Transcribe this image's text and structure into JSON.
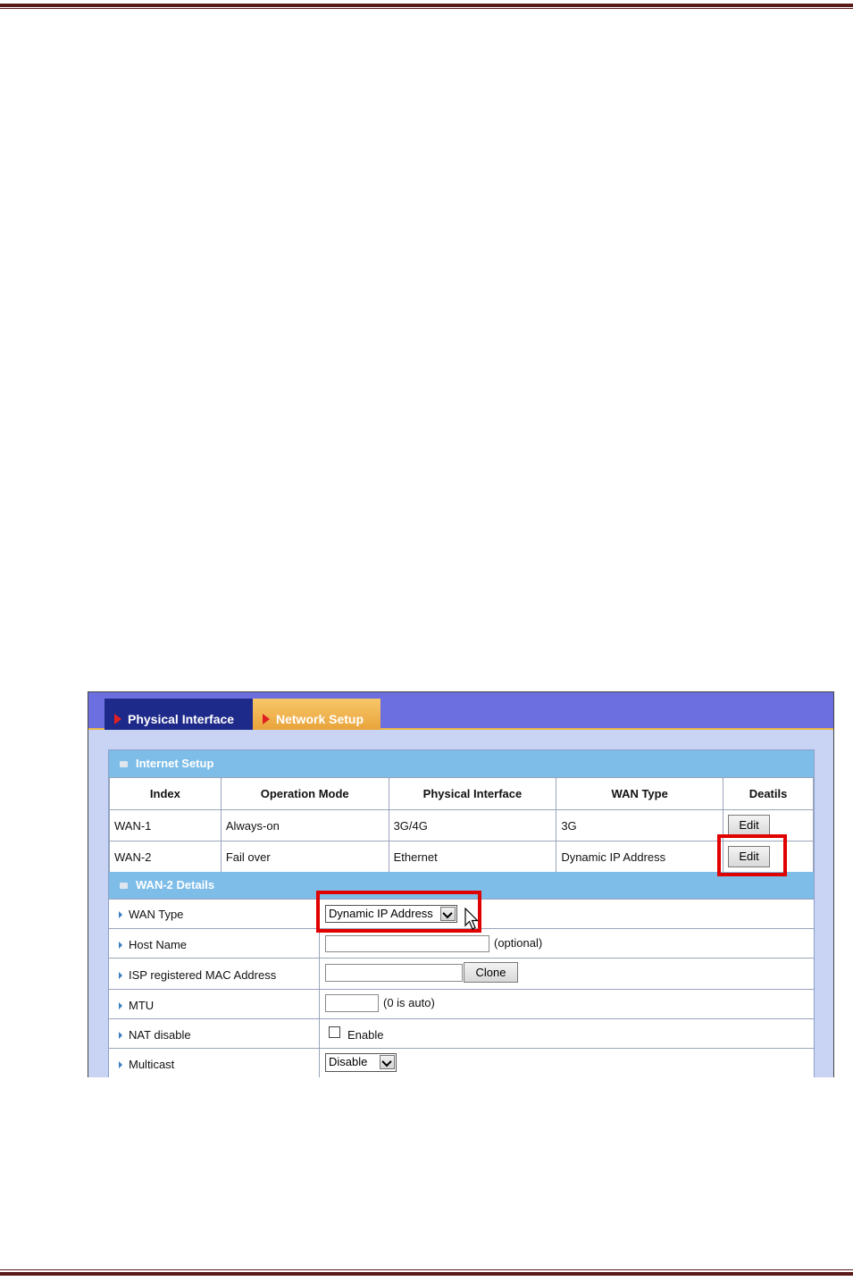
{
  "tabs": [
    {
      "label": "Physical Interface"
    },
    {
      "label": "Network Setup"
    }
  ],
  "internet_setup": {
    "title": "Internet Setup",
    "columns": [
      "Index",
      "Operation Mode",
      "Physical Interface",
      "WAN Type",
      "Deatils"
    ],
    "rows": [
      {
        "index": "WAN-1",
        "mode": "Always-on",
        "iface": "3G/4G",
        "wan_type": "3G",
        "action": "Edit"
      },
      {
        "index": "WAN-2",
        "mode": "Fail over",
        "iface": "Ethernet",
        "wan_type": "Dynamic IP Address",
        "action": "Edit"
      }
    ]
  },
  "details": {
    "title": "WAN-2 Details",
    "wan_type_label": "WAN Type",
    "wan_type_value": "Dynamic IP Address",
    "host_name_label": "Host Name",
    "host_name_hint": "(optional)",
    "mac_label": "ISP registered MAC Address",
    "clone_label": "Clone",
    "mtu_label": "MTU",
    "mtu_hint": "(0 is auto)",
    "nat_label": "NAT disable",
    "nat_option": "Enable",
    "multicast_label": "Multicast",
    "multicast_value": "Disable"
  },
  "colors": {
    "tabbar": "#6b6fe0",
    "section_header": "#7dbde8",
    "highlight": "#e00000"
  }
}
